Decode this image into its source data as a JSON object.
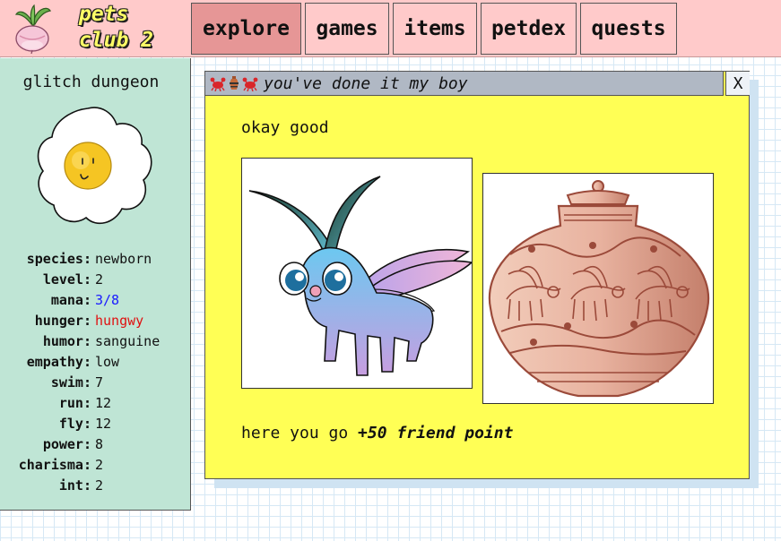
{
  "brand": {
    "line1": "pets",
    "line2": "club 2"
  },
  "nav": {
    "tabs": [
      {
        "label": "explore"
      },
      {
        "label": "games"
      },
      {
        "label": "items"
      },
      {
        "label": "petdex"
      },
      {
        "label": "quests"
      }
    ],
    "active": "explore"
  },
  "pet": {
    "name": "glitch dungeon",
    "stats": [
      {
        "label": "species:",
        "value": "newborn"
      },
      {
        "label": "level:",
        "value": "2"
      },
      {
        "label": "mana:",
        "value": "3/8"
      },
      {
        "label": "hunger:",
        "value": "hungwy"
      },
      {
        "label": "humor:",
        "value": "sanguine"
      },
      {
        "label": "empathy:",
        "value": "low"
      },
      {
        "label": "swim:",
        "value": "7"
      },
      {
        "label": "run:",
        "value": "12"
      },
      {
        "label": "fly:",
        "value": "12"
      },
      {
        "label": "power:",
        "value": "8"
      },
      {
        "label": "charisma:",
        "value": "2"
      },
      {
        "label": "int:",
        "value": "2"
      }
    ]
  },
  "modal": {
    "title": "you've done it my boy",
    "close_label": "X",
    "message": "okay good",
    "reward_prefix": "here you go ",
    "reward_bold": "+50 friend point"
  },
  "colors": {
    "header": "#ffcaca",
    "sidebar": "#bfe5d5",
    "modal": "#ffff55",
    "active_tab": "#e69696",
    "mana": "#1a1aff",
    "hunger": "#e01010"
  }
}
